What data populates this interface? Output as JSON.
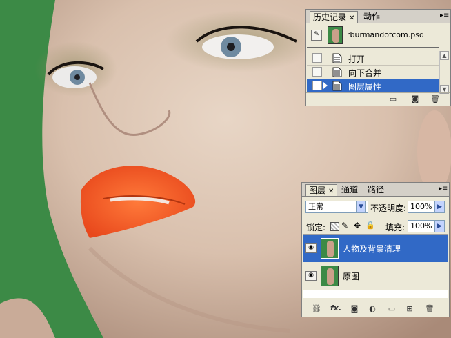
{
  "history_panel": {
    "tabs": [
      {
        "label": "历史记录",
        "close": "✕"
      },
      {
        "label": "动作"
      }
    ],
    "snapshot_name": "rburmandotcom.psd",
    "items": [
      {
        "label": "打开"
      },
      {
        "label": "向下合并"
      },
      {
        "label": "图层属性"
      }
    ],
    "selected_index": 2
  },
  "layers_panel": {
    "tabs": [
      {
        "label": "图层",
        "close": "✕"
      },
      {
        "label": "通道"
      },
      {
        "label": "路径"
      }
    ],
    "blend_mode": "正常",
    "opacity_label": "不透明度:",
    "opacity_value": "100%",
    "lock_label": "锁定:",
    "fill_label": "填充:",
    "fill_value": "100%",
    "layers": [
      {
        "name": "人物及背景清理",
        "visible": true,
        "selected": true
      },
      {
        "name": "原图",
        "visible": true,
        "selected": false
      }
    ],
    "footer_fx": "fx."
  },
  "icons": {
    "history_footer": [
      "new-document-icon",
      "camera-icon",
      "trash-icon"
    ],
    "layers_footer": [
      "link-icon",
      "fx-icon",
      "mask-icon",
      "adjustment-icon",
      "folder-icon",
      "new-layer-icon",
      "trash-icon"
    ]
  },
  "colors": {
    "panel_bg": "#ece9d8",
    "selection": "#3169c6",
    "green_screen": "#3c8a46",
    "lips": "#f05a28"
  }
}
